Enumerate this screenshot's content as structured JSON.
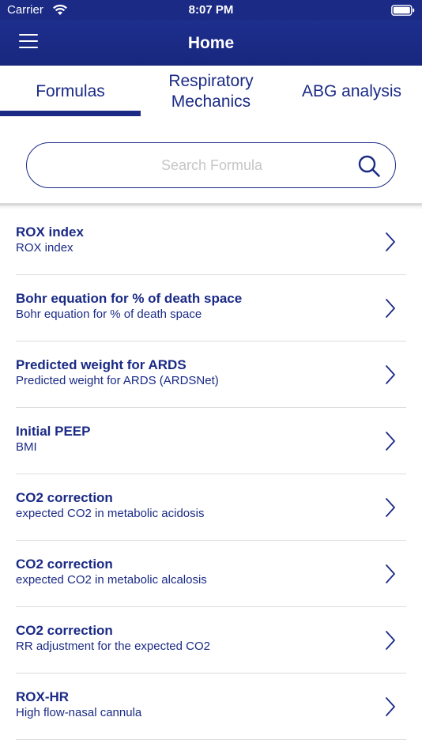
{
  "status_bar": {
    "carrier": "Carrier",
    "time": "8:07 PM",
    "wifi_icon": "wifi-icon",
    "battery_icon": "battery-icon"
  },
  "nav": {
    "title": "Home",
    "menu_icon": "hamburger-menu-icon"
  },
  "tabs": [
    {
      "label": "Formulas",
      "selected": true
    },
    {
      "label": "Respiratory Mechanics",
      "selected": false
    },
    {
      "label": "ABG analysis",
      "selected": false
    }
  ],
  "search": {
    "placeholder": "Search Formula",
    "value": "",
    "icon": "search-icon"
  },
  "formulas": [
    {
      "title": "ROX index",
      "subtitle": "ROX index"
    },
    {
      "title": "Bohr equation for % of death space",
      "subtitle": "Bohr equation for % of death space"
    },
    {
      "title": "Predicted weight for ARDS",
      "subtitle": "Predicted weight for ARDS (ARDSNet)"
    },
    {
      "title": "Initial PEEP",
      "subtitle": "BMI"
    },
    {
      "title": "CO2 correction",
      "subtitle": "expected CO2 in metabolic acidosis"
    },
    {
      "title": "CO2 correction",
      "subtitle": "expected CO2 in metabolic alcalosis"
    },
    {
      "title": "CO2 correction",
      "subtitle": "RR adjustment for the expected CO2"
    },
    {
      "title": "ROX-HR",
      "subtitle": "High flow-nasal cannula"
    }
  ],
  "colors": {
    "primary": "#1a2a85",
    "placeholder": "#c6c6c6",
    "divider": "#dddddd"
  }
}
